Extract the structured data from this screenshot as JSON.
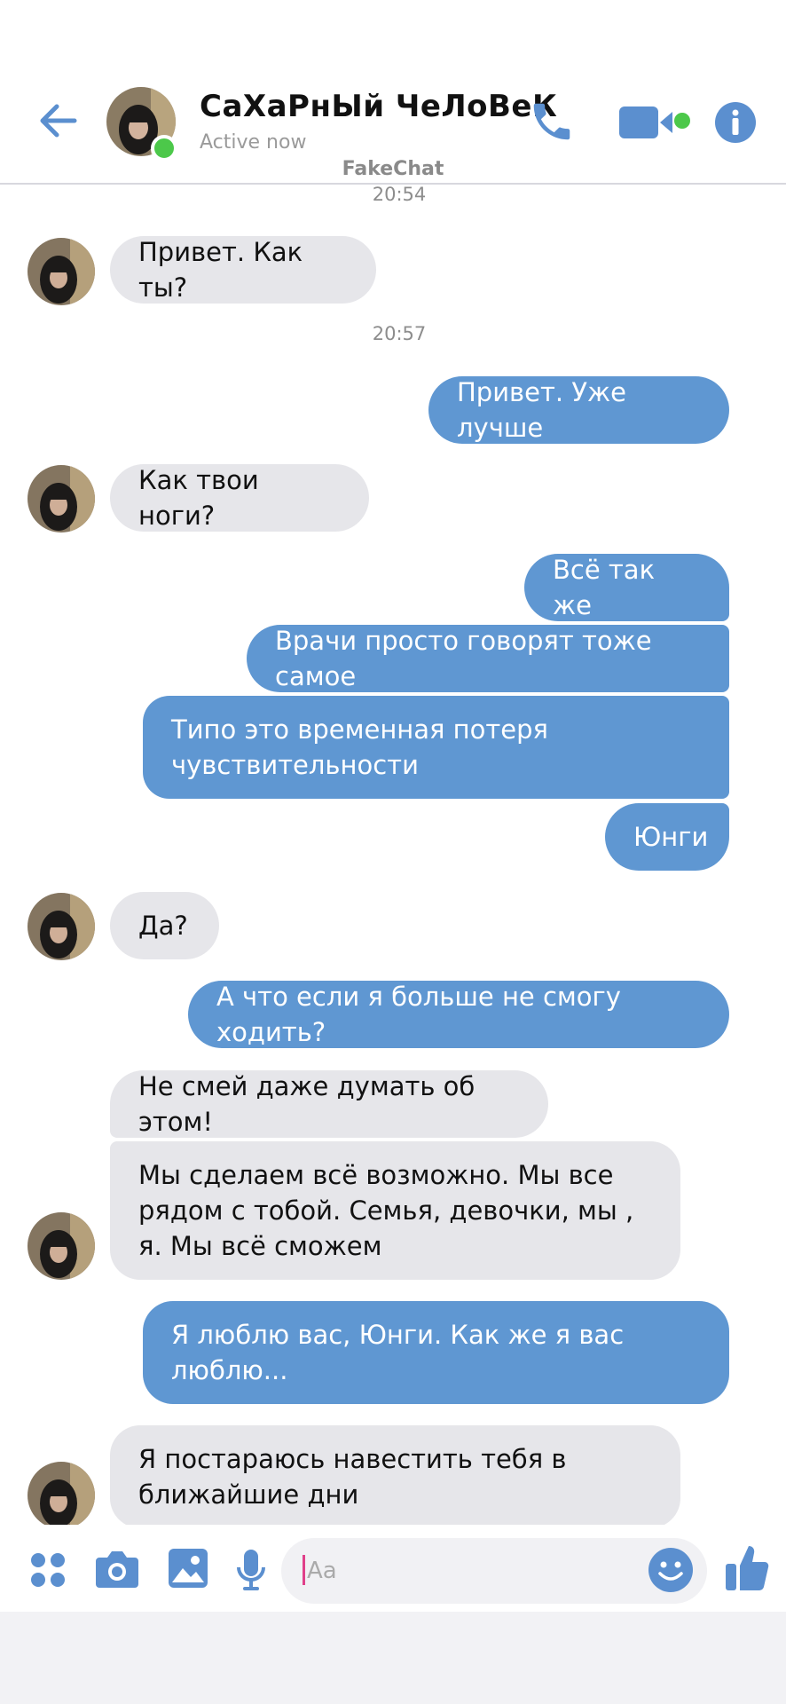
{
  "header": {
    "contact_name": "СаХаРнЫй ЧеЛоВеК",
    "status": "Active now",
    "watermark": "FakeChat"
  },
  "icons": {
    "back": "arrow-left-icon",
    "call": "phone-icon",
    "video": "video-camera-icon",
    "info": "info-icon",
    "apps": "grid-icon",
    "camera": "camera-icon",
    "gallery": "image-icon",
    "voice": "microphone-icon",
    "emoji": "smiley-icon",
    "like": "thumbs-up-icon"
  },
  "colors": {
    "accent": "#5b8fcf",
    "outgoing_bubble": "#5f97d2",
    "incoming_bubble": "#e6e6ea",
    "online": "#4cc84a"
  },
  "timestamps": [
    "20:54",
    "20:57"
  ],
  "messages": [
    {
      "text": "Привет. Как ты?"
    },
    {
      "text": "Привет. Уже лучше"
    },
    {
      "text": "Как твои ноги?"
    },
    {
      "text": "Всё так же"
    },
    {
      "text": "Врачи просто говорят тоже самое"
    },
    {
      "text": "Типо это временная потеря чувствительности"
    },
    {
      "text": "Юнги"
    },
    {
      "text": "Да?"
    },
    {
      "text": "А что если я больше не смогу ходить?"
    },
    {
      "text": "Не смей даже думать об этом!"
    },
    {
      "text": "Мы сделаем всё возможно. Мы все рядом с тобой. Семья, девочки, мы , я. Мы всё сможем"
    },
    {
      "text": "Я люблю вас, Юнги. Как же я вас люблю..."
    },
    {
      "text": "Я постараюсь навестить тебя в ближайшие дни"
    }
  ],
  "composer": {
    "placeholder": "Aa"
  }
}
